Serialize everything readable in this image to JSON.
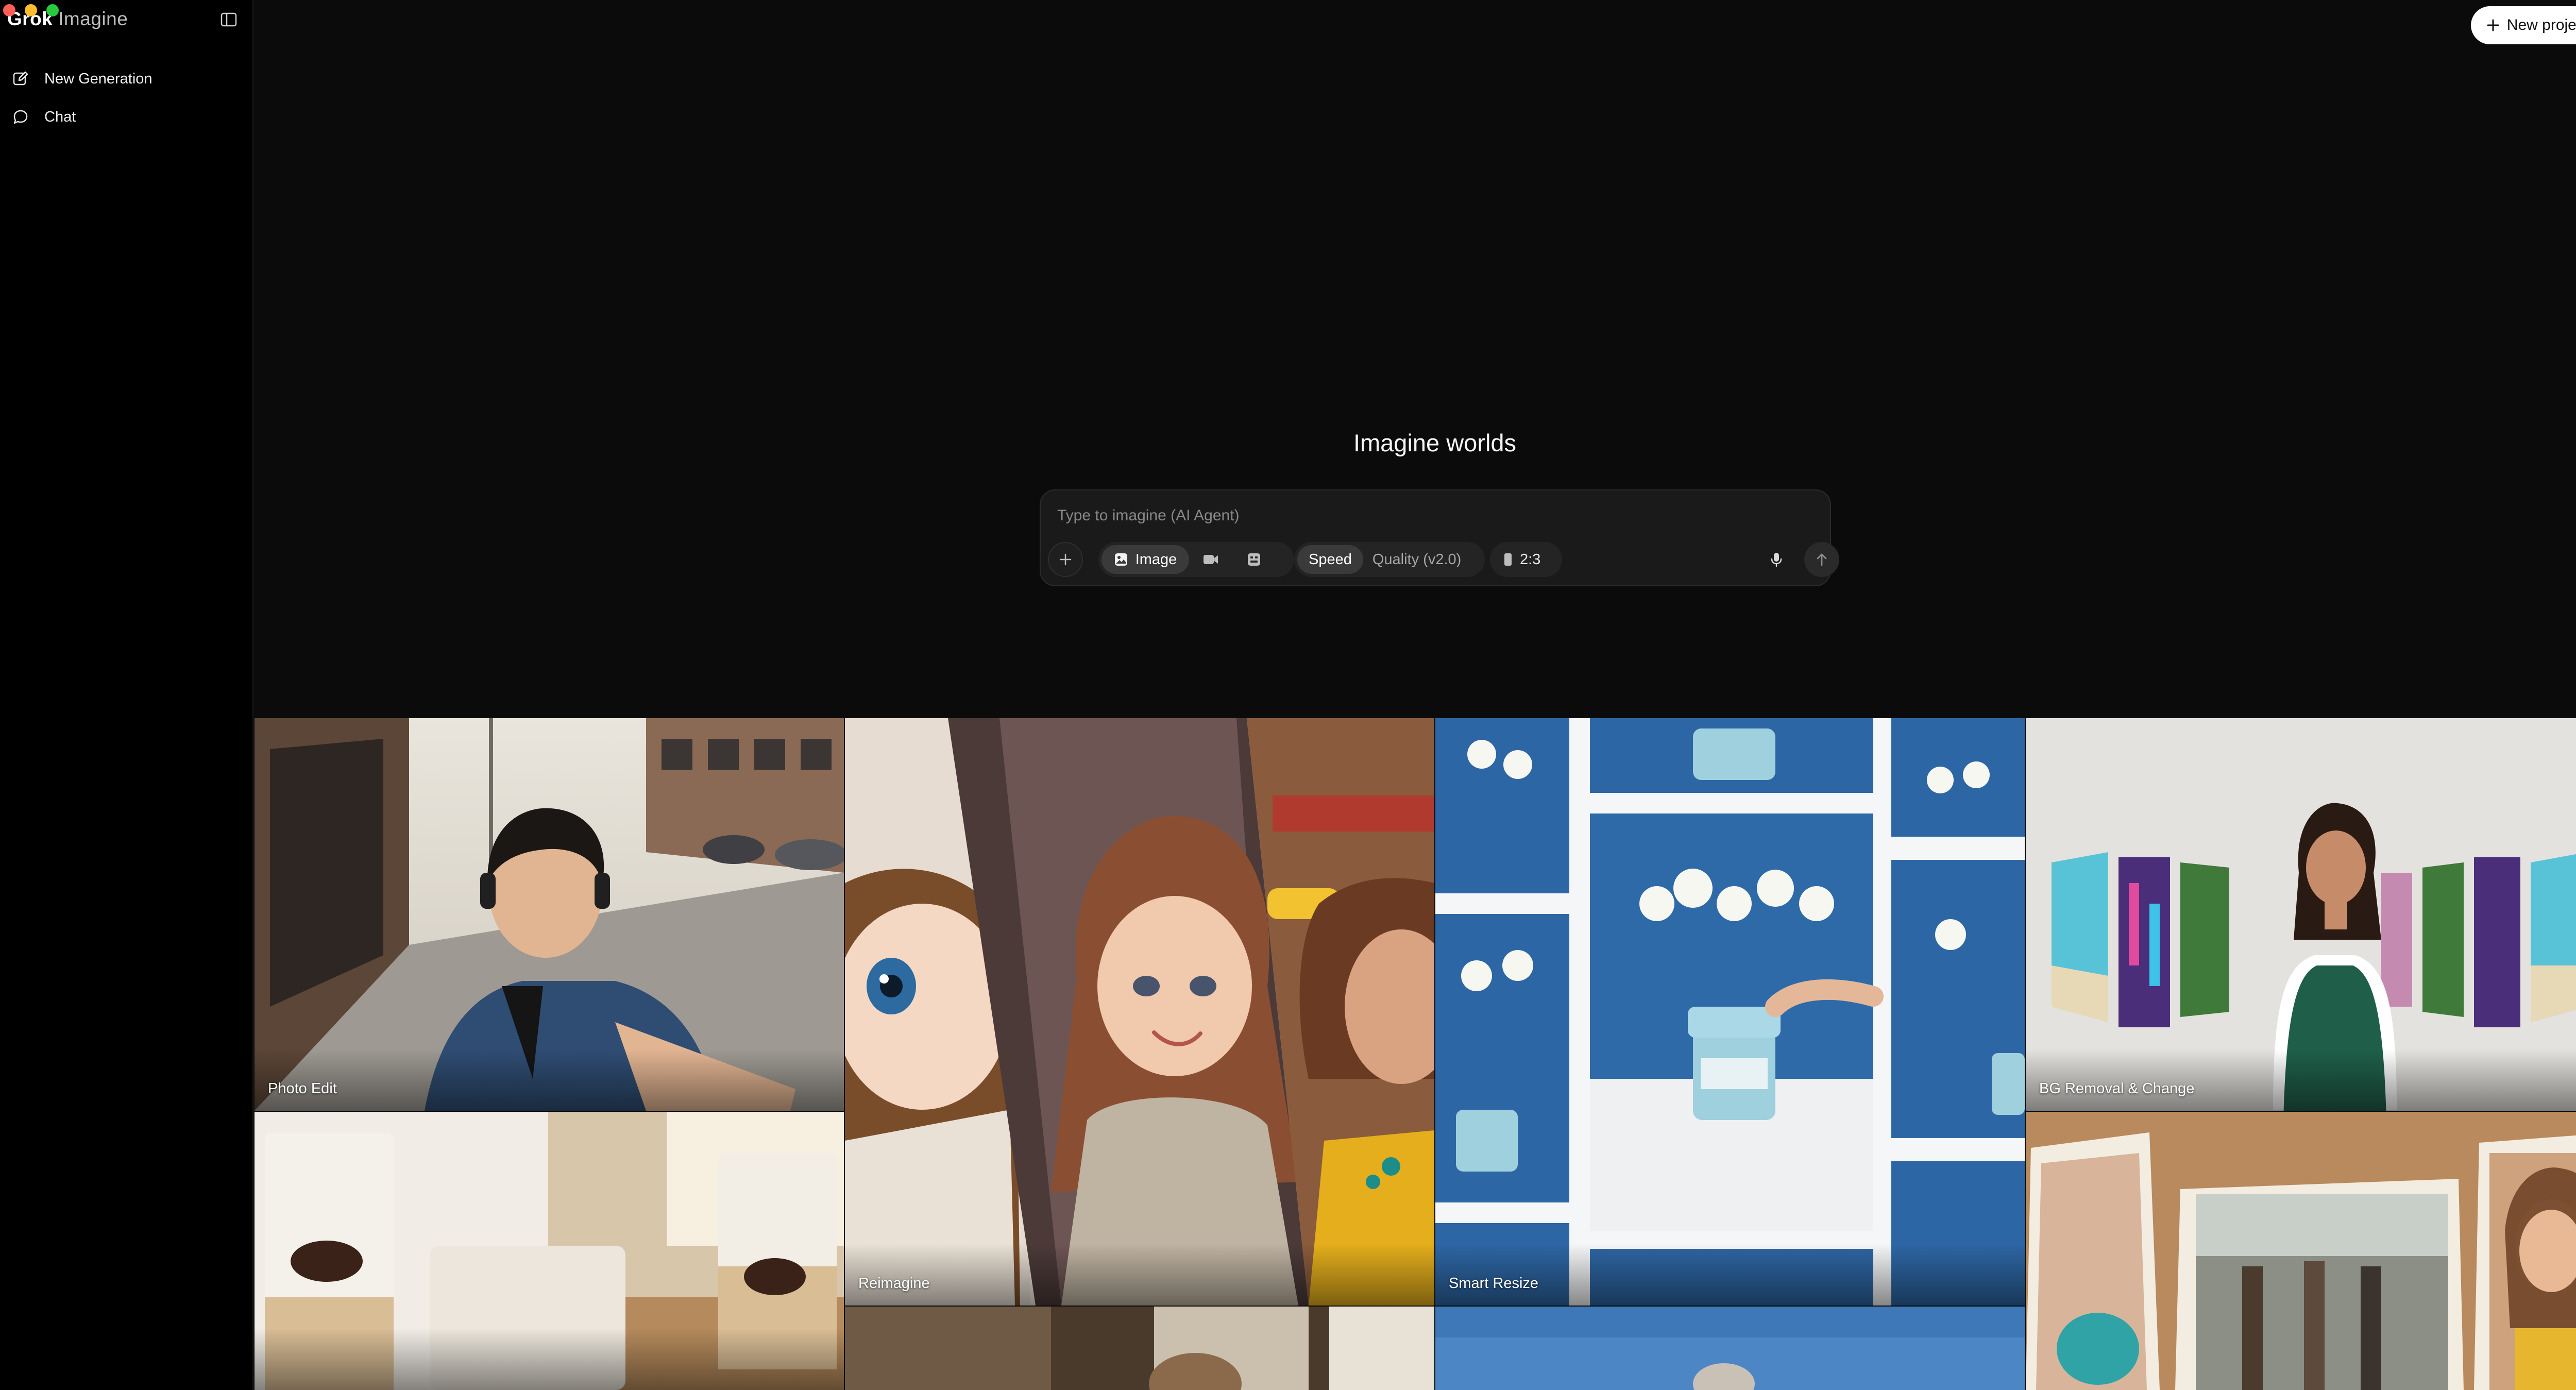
{
  "app": {
    "brand_primary": "Grok",
    "brand_secondary": "Imagine"
  },
  "window_controls": {
    "close": "#ff5f57",
    "minimize": "#febc2e",
    "maximize": "#28c840"
  },
  "sidebar": {
    "toggle_icon": "sidebar-panel-icon",
    "items": [
      {
        "label": "New Generation",
        "icon": "edit-icon"
      },
      {
        "label": "Chat",
        "icon": "chat-bubble-icon"
      }
    ]
  },
  "header": {
    "new_project_label": "New project",
    "new_project_icon": "plus-icon"
  },
  "hero": {
    "title": "Imagine worlds"
  },
  "composer": {
    "placeholder": "Type to imagine (AI Agent)",
    "value": "",
    "mode": {
      "selected_label": "Image",
      "options": [
        "image-icon",
        "video-icon",
        "template-icon"
      ]
    },
    "speed": {
      "selected": "Speed",
      "other": "Quality (v2.0)"
    },
    "aspect_ratio": "2:3",
    "mic_icon": "microphone-icon",
    "send_icon": "arrow-up-icon"
  },
  "gallery": {
    "tiles": [
      {
        "label": "Photo Edit"
      },
      {
        "label": "Reimagine"
      },
      {
        "label": "Smart Resize"
      },
      {
        "label": "BG Removal & Change"
      },
      {
        "label": ""
      },
      {
        "label": ""
      },
      {
        "label": ""
      },
      {
        "label": ""
      }
    ]
  }
}
